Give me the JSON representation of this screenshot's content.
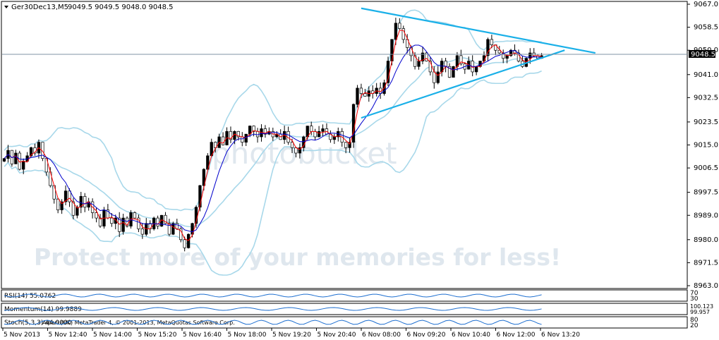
{
  "chart_data": {
    "type": "candlestick",
    "title": "Ger30Dec13,M5  9049.5 9049.5 9048.0 9048.5",
    "symbol": "Ger30Dec13,M5",
    "ohlc_header": "9049.5 9049.5 9048.0 9048.5",
    "current_price": "9048.5",
    "y_ticks": [
      "9067.0",
      "9058.5",
      "9050.0",
      "9041.0",
      "9032.5",
      "9023.5",
      "9015.0",
      "9006.5",
      "8997.5",
      "8989.0",
      "8980.0",
      "8971.5",
      "8963.0"
    ],
    "ylim": [
      8963.0,
      9067.0
    ],
    "x_ticks": [
      "5 Nov 2013",
      "5 Nov 12:40",
      "5 Nov 14:00",
      "5 Nov 15:20",
      "5 Nov 16:40",
      "5 Nov 18:00",
      "5 Nov 19:20",
      "5 Nov 20:40",
      "6 Nov 08:00",
      "6 Nov 09:20",
      "6 Nov 10:40",
      "6 Nov 12:00",
      "6 Nov 13:20"
    ],
    "close_series": [
      9010,
      9013,
      9008,
      9012,
      9006,
      9009,
      9011,
      9014,
      9012,
      9016,
      9010,
      9005,
      9000,
      8995,
      8991,
      8994,
      8998,
      8994,
      8989,
      8992,
      8996,
      8992,
      8994,
      8990,
      8988,
      8985,
      8991,
      8988,
      8986,
      8988,
      8983,
      8988,
      8985,
      8990,
      8988,
      8984,
      8982,
      8986,
      8984,
      8988,
      8985,
      8989,
      8986,
      8982,
      8986,
      8984,
      8980,
      8977,
      8982,
      8986,
      8992,
      9000,
      9006,
      9011,
      9016,
      9014,
      9018,
      9015,
      9020,
      9017,
      9020,
      9018,
      9016,
      9019,
      9022,
      9020,
      9018,
      9021,
      9019,
      9020,
      9018,
      9019,
      9017,
      9020,
      9016,
      9014,
      9012,
      9014,
      9018,
      9022,
      9020,
      9018,
      9020,
      9021,
      9019,
      9017,
      9018,
      9020,
      9016,
      9014,
      9016,
      9030,
      9036,
      9034,
      9033,
      9035,
      9034,
      9036,
      9034,
      9038,
      9046,
      9054,
      9060,
      9058,
      9054,
      9051,
      9048,
      9044,
      9046,
      9049,
      9046,
      9042,
      9038,
      9042,
      9046,
      9044,
      9040,
      9044,
      9048,
      9045,
      9043,
      9046,
      9042,
      9044,
      9046,
      9048,
      9054,
      9052,
      9050,
      9049,
      9047,
      9048,
      9050,
      9049,
      9046,
      9044,
      9047,
      9049,
      9048,
      9047,
      9048
    ],
    "indicators": [
      {
        "name": "RSI(14)",
        "value": "55.0762",
        "scale": [
          "70",
          "30"
        ]
      },
      {
        "name": "Momentum(14)",
        "value": "99.9889",
        "scale": [
          "100.123",
          "99.957"
        ]
      },
      {
        "name": "Stoch(5,3,3)",
        "value": "44.0000",
        "scale": [
          "80",
          "20"
        ]
      }
    ],
    "copyright": "Alpari (UK) MetaTrader 4, © 2001-2013, MetaQuotas Software Corp.",
    "trendlines": [
      {
        "name": "upper-trendline",
        "from": {
          "bar": 93,
          "price": 9065.5
        },
        "to": {
          "bar": 154,
          "price": 9049.0
        }
      },
      {
        "name": "lower-trendline",
        "from": {
          "bar": 93,
          "price": 9025.0
        },
        "to": {
          "bar": 146,
          "price": 9050.0
        }
      }
    ],
    "colors": {
      "bull": "#000000",
      "bear": "#ffffff",
      "ma_fast": "#ff0000",
      "ma_slow": "#0000cc",
      "bands": "#a8d8ea",
      "trend": "#1ab0e8",
      "price_line": "#7f93a4"
    },
    "grid": false,
    "watermark": "Protect more of your memories for less!",
    "watermark_brand": "photobucket"
  }
}
